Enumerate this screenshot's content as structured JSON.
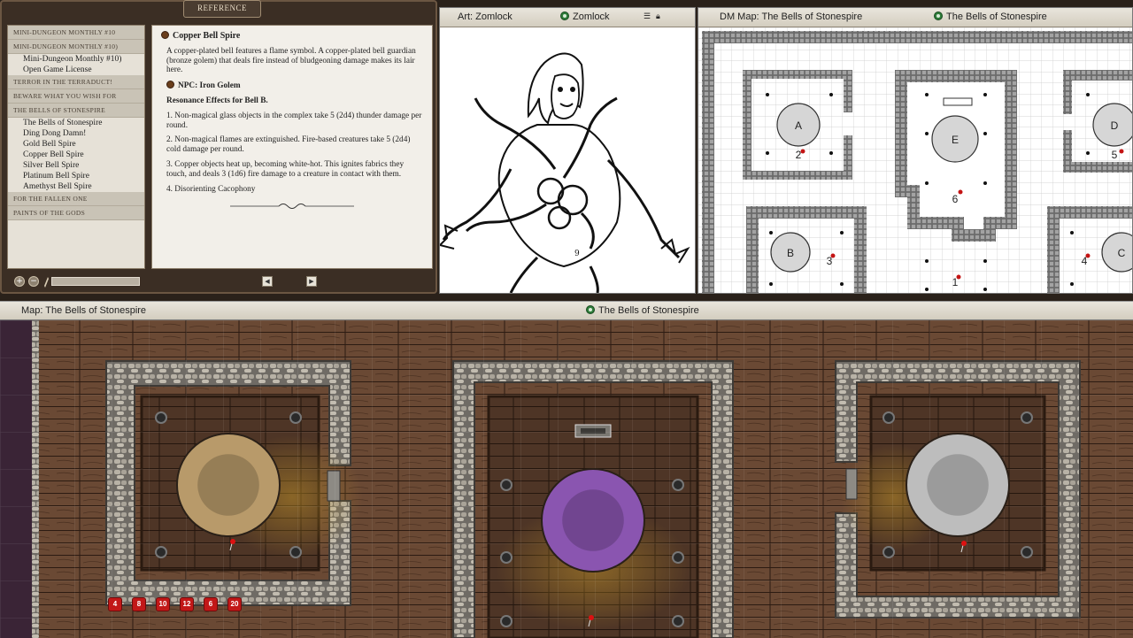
{
  "reference": {
    "tab_label": "REFERENCE",
    "toc": [
      {
        "kind": "section",
        "label": "MINI-DUNGEON MONTHLY #10"
      },
      {
        "kind": "section",
        "label": "MINI-DUNGEON MONTHLY #10)"
      },
      {
        "kind": "item",
        "label": "Mini-Dungeon Monthly #10)"
      },
      {
        "kind": "item",
        "label": "Open Game License"
      },
      {
        "kind": "section",
        "label": "TERROR IN THE TERRADUCT!"
      },
      {
        "kind": "section",
        "label": "BEWARE WHAT YOU WISH FOR"
      },
      {
        "kind": "section",
        "label": "THE BELLS OF STONESPIRE"
      },
      {
        "kind": "item",
        "label": "The Bells of Stonespire"
      },
      {
        "kind": "item",
        "label": "Ding Dong Damn!"
      },
      {
        "kind": "item",
        "label": "Gold Bell Spire"
      },
      {
        "kind": "item",
        "label": "Copper Bell Spire"
      },
      {
        "kind": "item",
        "label": "Silver Bell Spire"
      },
      {
        "kind": "item",
        "label": "Platinum Bell Spire"
      },
      {
        "kind": "item",
        "label": "Amethyst Bell Spire"
      },
      {
        "kind": "section",
        "label": "FOR THE FALLEN ONE"
      },
      {
        "kind": "section",
        "label": "PAINTS OF THE GODS"
      }
    ],
    "content": {
      "heading": "Copper Bell Spire",
      "intro": "A copper-plated bell features a flame symbol. A copper-plated bell guardian (bronze golem) that deals fire instead of bludgeoning damage makes its lair here.",
      "npc": "NPC: Iron Golem",
      "effects_title": "Resonance Effects for Bell B.",
      "effects": [
        "1. Non-magical glass objects in the complex take 5 (2d4) thunder damage per round.",
        "2. Non-magical flames are extinguished. Fire-based creatures take 5 (2d4) cold damage per round.",
        "3. Copper objects heat up, becoming white-hot. This ignites fabrics they touch, and deals 3 (1d6) fire damage to a creature in contact with them.",
        "4. Disorienting Cacophony"
      ]
    },
    "bottom": {
      "add": "+",
      "remove": "−",
      "prev": "◀",
      "next": "▶"
    }
  },
  "art_window": {
    "title": "Art: Zomlock",
    "link_label": "Zomlock",
    "page_number": "9"
  },
  "dm_map": {
    "title": "DM Map: The Bells of Stonespire",
    "link_label": "The Bells of Stonespire",
    "rooms": [
      "A",
      "E",
      "D",
      "B",
      "C"
    ],
    "numbers": [
      "2",
      "6",
      "5",
      "3",
      "4",
      "1"
    ]
  },
  "main_map": {
    "title": "Map: The Bells of Stonespire",
    "link_label": "The Bells of Stonespire",
    "bells": [
      {
        "name": "Copper bell",
        "color": "#b89a6a"
      },
      {
        "name": "Amethyst bell",
        "color": "#8a55b0"
      },
      {
        "name": "Silver bell",
        "color": "#bdbdbd"
      }
    ],
    "dice": [
      "4",
      "8",
      "10",
      "12",
      "6",
      "20"
    ]
  },
  "colors": {
    "parchment": "#f2efe9",
    "toc_bg": "#e6e1d7",
    "wood": "#5a3d2b",
    "die": "#c21818"
  }
}
